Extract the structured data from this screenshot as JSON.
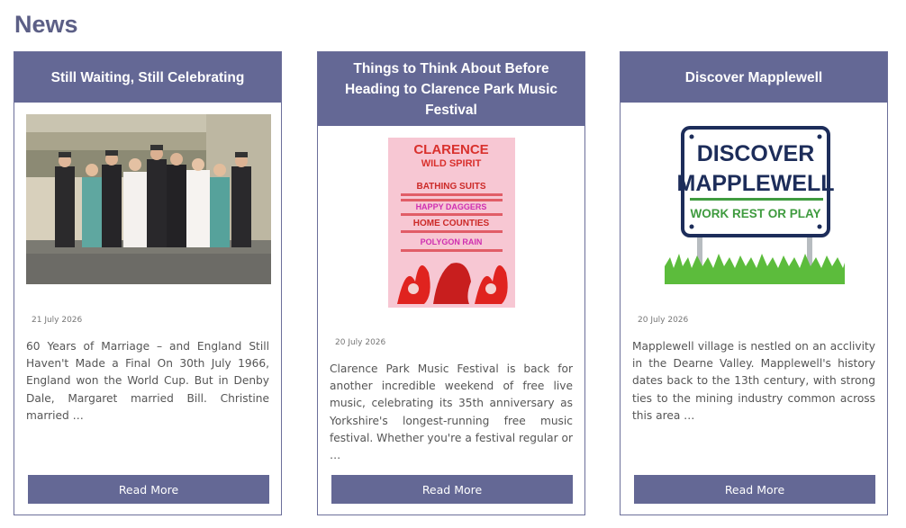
{
  "section": {
    "title": "News"
  },
  "cards": [
    {
      "title": "Still Waiting, Still Celebrating",
      "image_alt": "wedding-party-photo",
      "date": "21 July 2026",
      "excerpt": "60 Years of Marriage – and England Still Haven't Made a Final On 30th July 1966, England won the World Cup. But in Denby Dale, Margaret married Bill. Christine married …",
      "button": "Read More"
    },
    {
      "title": "Things to Think About Before Heading to Clarence Park Music Festival",
      "image_alt": "festival-poster",
      "poster": {
        "heading1": "CLARENCE",
        "heading2": "WILD SPIRIT",
        "band1": "BATHING SUITS",
        "band2": "HAPPY DAGGERS",
        "band3": "HOME COUNTIES",
        "band4": "POLYGON RAIN"
      },
      "date": "20 July 2026",
      "excerpt": "Clarence Park Music Festival is back for another incredible weekend of free live music, celebrating its 35th anniversary as Yorkshire's longest-running free music festival. Whether you're a festival regular or …",
      "button": "Read More"
    },
    {
      "title": "Discover Mapplewell",
      "image_alt": "discover-mapplewell-sign",
      "sign": {
        "line1": "DISCOVER",
        "line2": "MAPPLEWELL",
        "tagline": "WORK REST OR PLAY"
      },
      "date": "20 July 2026",
      "excerpt": "Mapplewell village is nestled on an acclivity in the Dearne Valley. Mapplewell's history dates back to the 13th century, with strong ties to the mining industry common across this area …",
      "button": "Read More"
    }
  ],
  "colors": {
    "brand": "#646895",
    "heading": "#5c5f86"
  }
}
